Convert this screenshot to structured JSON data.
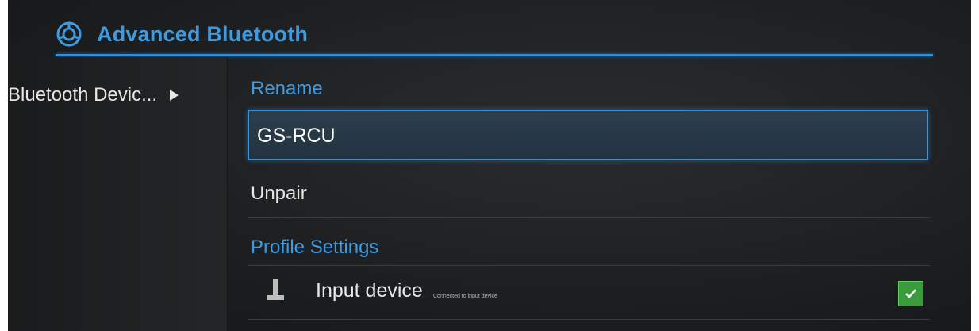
{
  "header": {
    "title": "Advanced Bluetooth",
    "icon": "bluetooth-settings-icon"
  },
  "sidebar": {
    "items": [
      {
        "label": "Bluetooth Devic...",
        "icon": "chevron-right-icon"
      }
    ]
  },
  "main": {
    "rename": {
      "heading": "Rename",
      "value": "GS-RCU"
    },
    "unpair_label": "Unpair",
    "profile_settings": {
      "heading": "Profile Settings",
      "profiles": [
        {
          "label": "Input device",
          "status": "Connected to input device",
          "icon": "joystick-icon",
          "checked": true
        }
      ]
    }
  },
  "colors": {
    "accent": "#3f9be0",
    "check": "#3a9b3d"
  }
}
